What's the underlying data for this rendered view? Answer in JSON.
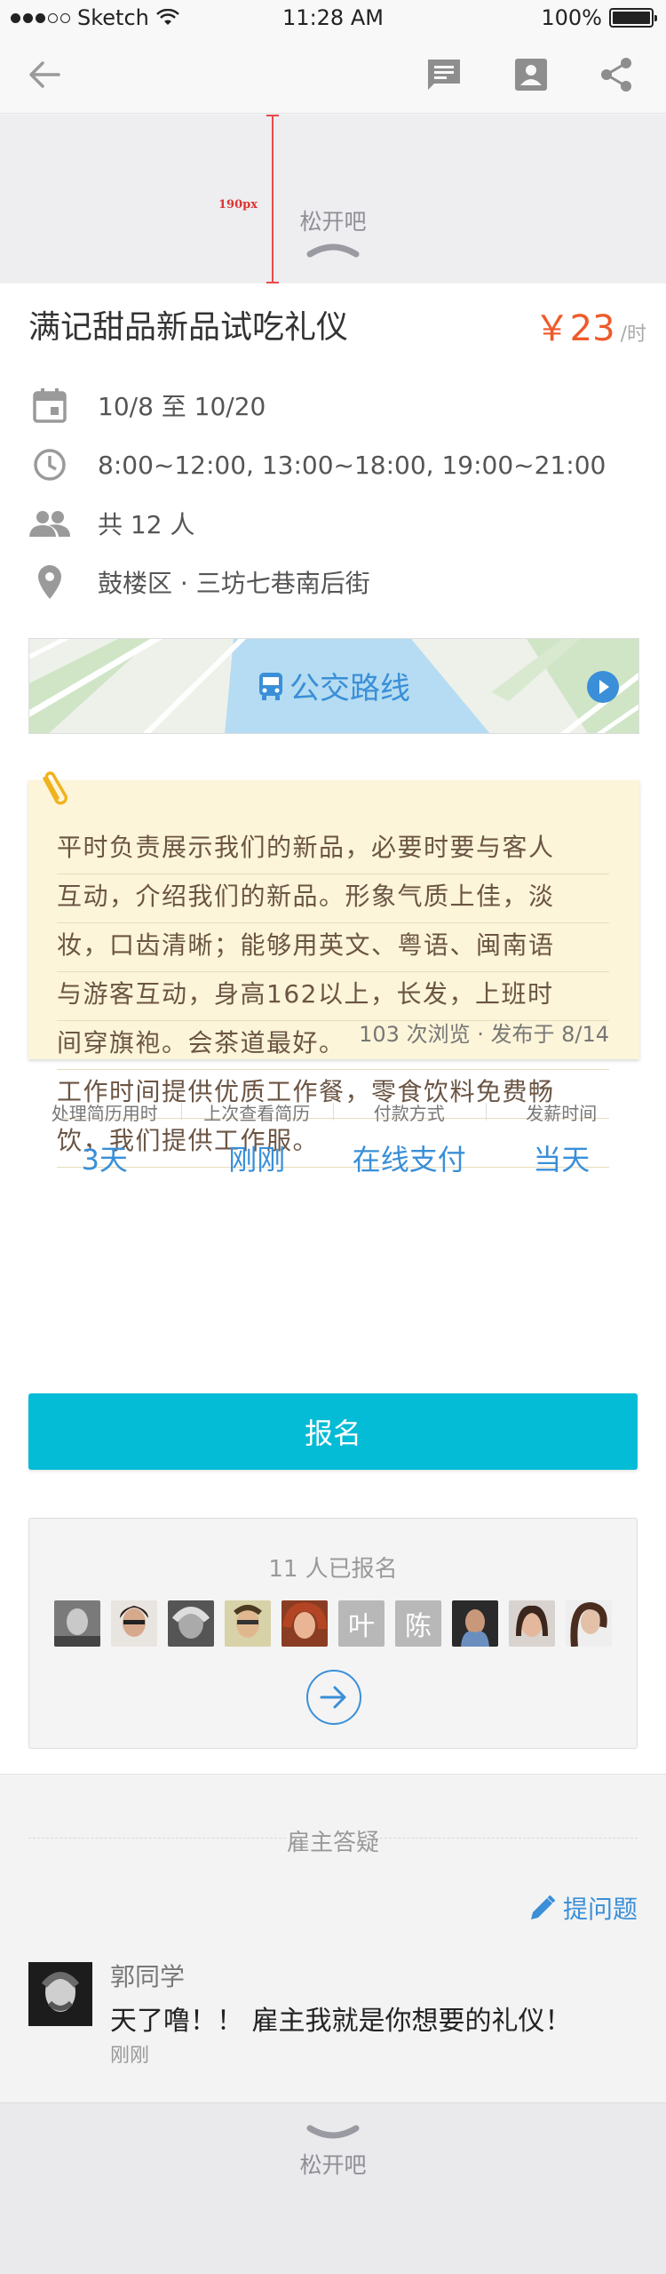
{
  "status_bar": {
    "carrier": "Sketch",
    "time": "11:28 AM",
    "battery": "100%"
  },
  "nav": {
    "back_icon": "back-arrow-icon",
    "icons": [
      "message-icon",
      "contact-card-icon",
      "share-icon"
    ]
  },
  "pull_top": {
    "measure_label": "190px",
    "text": "松开吧"
  },
  "job": {
    "title": "满记甜品新品试吃礼仪",
    "price": "￥23",
    "price_unit": "/时",
    "date": "10/8 至 10/20",
    "hours": "8:00~12:00, 13:00~18:00, 19:00~21:00",
    "headcount": "共 12 人",
    "location": "鼓楼区 · 三坊七巷南后街"
  },
  "map": {
    "label": "公交路线"
  },
  "description": {
    "lines": [
      "平时负责展示我们的新品，必要时要与客人",
      "互动，介绍我们的新品。形象气质上佳，淡",
      "妆，口齿清晰；能够用英文、粤语、闽南语",
      "与游客互动，身高162以上，长发，上班时",
      "间穿旗袍。会茶道最好。",
      "工作时间提供优质工作餐，零食饮料免费畅",
      "饮，我们提供工作服。"
    ],
    "meta": "103 次浏览 · 发布于 8/14"
  },
  "stats": [
    {
      "label": "处理简历用时",
      "value": "3天"
    },
    {
      "label": "上次查看简历",
      "value": "刚刚"
    },
    {
      "label": "付款方式",
      "value": "在线支付"
    },
    {
      "label": "发薪时间",
      "value": "当天"
    }
  ],
  "signup_label": "报名",
  "applicants": {
    "count": "11 人已报名",
    "letters": [
      "叶",
      "陈"
    ]
  },
  "qa": {
    "header": "雇主答疑",
    "ask_label": "提问题",
    "item": {
      "name": "郭同学",
      "content": "天了噜！！ 雇主我就是你想要的礼仪！",
      "time": "刚刚"
    }
  },
  "pull_bottom": {
    "text": "松开吧"
  },
  "colors": {
    "accent": "#3a8fd8",
    "price": "#ef5a2a",
    "cta": "#05bcd6",
    "note_bg": "#fdf5d9"
  }
}
